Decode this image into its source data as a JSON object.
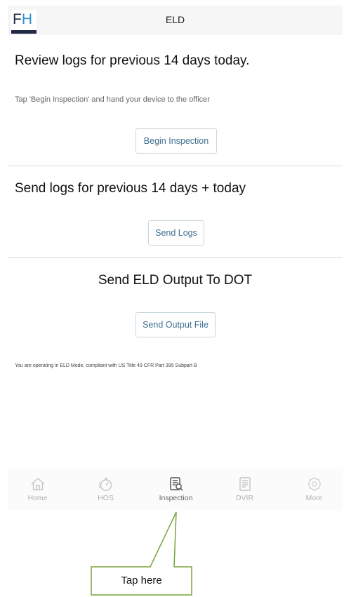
{
  "header": {
    "logo_text_f": "F",
    "logo_text_h": "H",
    "title": "ELD"
  },
  "review": {
    "heading": "Review logs for previous 14 days today.",
    "note": "Tap 'Begin Inspection' and hand your device to the officer",
    "button_label": "Begin Inspection"
  },
  "send_logs": {
    "heading": "Send logs for previous 14 days + today",
    "button_label": "Send Logs"
  },
  "send_output": {
    "heading": "Send ELD Output To DOT",
    "button_label": "Send Output File"
  },
  "footnote": "You are operating in ELD Mode, compliant with US Title 49 CFR Part 395 Subpart B",
  "nav": {
    "items": [
      {
        "label": "Home",
        "icon": "home-icon",
        "active": false
      },
      {
        "label": "HOS",
        "icon": "stopwatch-icon",
        "active": false
      },
      {
        "label": "Inspection",
        "icon": "inspection-icon",
        "active": true
      },
      {
        "label": "DVIR",
        "icon": "document-icon",
        "active": false
      },
      {
        "label": "More",
        "icon": "gear-icon",
        "active": false
      }
    ]
  },
  "callout": {
    "label": "Tap here",
    "border_color": "#7aa33f"
  }
}
